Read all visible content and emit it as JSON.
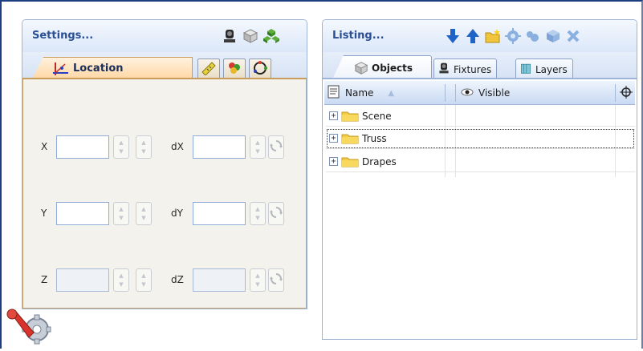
{
  "settings": {
    "title": "Settings...",
    "header_icons": [
      "fixture-icon",
      "cube-icon",
      "group-icon"
    ],
    "tabs": [
      {
        "name": "location-icon",
        "label": "Location",
        "active": true
      },
      {
        "name": "ruler-icon",
        "label": "",
        "active": false
      },
      {
        "name": "color-icon",
        "label": "",
        "active": false
      },
      {
        "name": "rotate-icon",
        "label": "",
        "active": false
      }
    ],
    "fields": {
      "x": {
        "label": "X",
        "value": ""
      },
      "dx": {
        "label": "dX",
        "value": ""
      },
      "y": {
        "label": "Y",
        "value": ""
      },
      "dy": {
        "label": "dY",
        "value": ""
      },
      "z": {
        "label": "Z",
        "value": ""
      },
      "dz": {
        "label": "dZ",
        "value": ""
      }
    }
  },
  "listing": {
    "title": "Listing...",
    "toolbar_icons": [
      "arrow-down-icon",
      "arrow-up-icon",
      "new-folder-icon",
      "gear-icon",
      "link-icon",
      "box-icon",
      "delete-icon"
    ],
    "tabs": [
      {
        "label": "Objects",
        "active": true
      },
      {
        "label": "Fixtures",
        "active": false
      },
      {
        "label": "Layers",
        "active": false
      }
    ],
    "columns": {
      "name": "Name",
      "visible": "Visible"
    },
    "rows": [
      {
        "label": "Scene"
      },
      {
        "label": "Truss"
      },
      {
        "label": "Drapes"
      }
    ]
  },
  "colors": {
    "accent": "#2a4f96",
    "active_tab": "#ffd7a3",
    "toolbar_blue": "#1d63c8"
  }
}
